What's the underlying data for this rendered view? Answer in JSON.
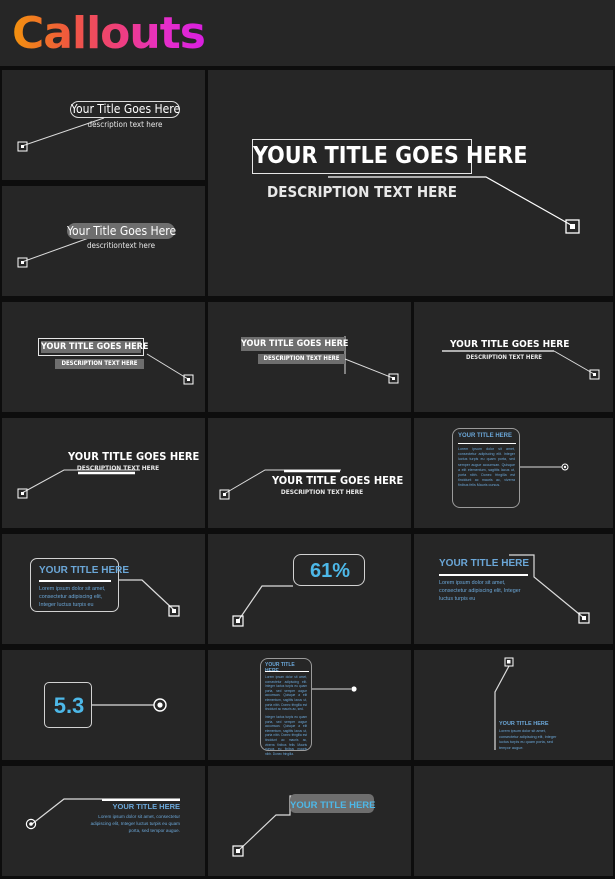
{
  "header": {
    "title": "Callouts"
  },
  "theme": {
    "page_bg": "#0d0d0d",
    "cell_bg": "#262626",
    "accent_blue": "#6ba7d8",
    "accent_blue_bright": "#4db8e8",
    "gray_fill": "#6e6e6e",
    "line": "#dcdcdc",
    "title_gradient_from": "#f2930d",
    "title_gradient_to": "#d81fe0"
  },
  "callouts": [
    {
      "id": "pill-outline",
      "title": "Your Title Goes Here",
      "description": "description text here",
      "marker": "square-marker"
    },
    {
      "id": "hero-boxed",
      "title": "YOUR TITLE GOES HERE",
      "description": "DESCRIPTION TEXT HERE",
      "marker": "square-marker"
    },
    {
      "id": "pill-filled",
      "title": "Your Title Goes Here",
      "description": "descritiontext here",
      "marker": "square-marker"
    },
    {
      "id": "boxed-gray-bars",
      "title": "YOUR TITLE GOES HERE",
      "description": "DESCRIPTION TEXT HERE",
      "marker": "square-marker"
    },
    {
      "id": "gray-bars-vline",
      "title": "YOUR TITLE GOES HERE",
      "description": "DESCRIPTION TEXT HERE",
      "marker": "square-marker"
    },
    {
      "id": "underline-rule",
      "title": "YOUR TITLE GOES HERE",
      "description": "DESCRIPTION TEXT HERE",
      "marker": "square-marker"
    },
    {
      "id": "underline-below",
      "title": "YOUR TITLE GOES HERE",
      "description": "DESCRIPTION TEXT HERE",
      "marker": "square-marker"
    },
    {
      "id": "overline-above",
      "title": "YOUR TITLE GOES HERE",
      "description": "DESCRIPTION TEXT HERE",
      "marker": "square-marker"
    },
    {
      "id": "blue-card-tall",
      "title": "YOUR TITLE HERE",
      "body": "Lorem ipsum dolor sit amet, consectetur adipiscing elit. Integer luctus turpis eu quam porta, sed semper augue accumsan. Quisque a elit elementum, sagittis lacus ut, porta nibh. Donec fringilla est tincidunt ac mauris ac, viverra finibus felis Mauris cursus.",
      "marker": "dot-marker"
    },
    {
      "id": "blue-card-short",
      "title": "YOUR TITLE HERE",
      "body": "Lorem ipsum dolor sit amet, consectetur adipiscing elit, Integer luctus turpis eu",
      "marker": "square-marker"
    },
    {
      "id": "percent-pill",
      "value": "61%",
      "marker": "square-marker"
    },
    {
      "id": "blue-plain",
      "title": "YOUR TITLE HERE",
      "body": "Lorem ipsum dolor sit amet, consectetur adipiscing elit, Integer luctus turpis eu",
      "marker": "square-marker"
    },
    {
      "id": "number-box",
      "value": "5.3",
      "marker": "circle-marker"
    },
    {
      "id": "blue-card-column",
      "title": "YOUR TITLE HERE",
      "body1": "Lorem ipsum dolor sit amet, consectetur adipiscing elit. Integer luctus turpis eu quam porta, sed semper augue accumsan. Quisque a elit elementum, sagittis lacus ut, porta nibh. Donec fringilla est tincidunt ac mauris ac, sed.",
      "body2": "Integer luctus turpis eu quam porta, sed semper augue accumsan. Quisque a elit elementum, sagittis lacus ut, porta nibh. Donec fringilla est tincidunt ac mauris ac, viverra finibus felis Mauris cursus eu finibus mauris nibh. Donec fringilla.",
      "marker": "dot-marker"
    },
    {
      "id": "vertical-stem",
      "title": "YOUR TITLE HERE",
      "body": "Lorem ipsum dolor sit amet, consectetur adipiscing elit, Integer luctus turpis eu quam porta, sed tempor augue.",
      "marker": "square-marker"
    },
    {
      "id": "right-aligned",
      "title": "YOUR TITLE HERE",
      "body": "Lorem ipsum dolor sit amet, consectetur adipiscing elit, Integer luctus turpis eu quam porta, sed tempor augue.",
      "marker": "circle-marker"
    },
    {
      "id": "gray-pill-blue-text",
      "title": "YOUR TITLE HERE",
      "marker": "square-marker"
    }
  ]
}
